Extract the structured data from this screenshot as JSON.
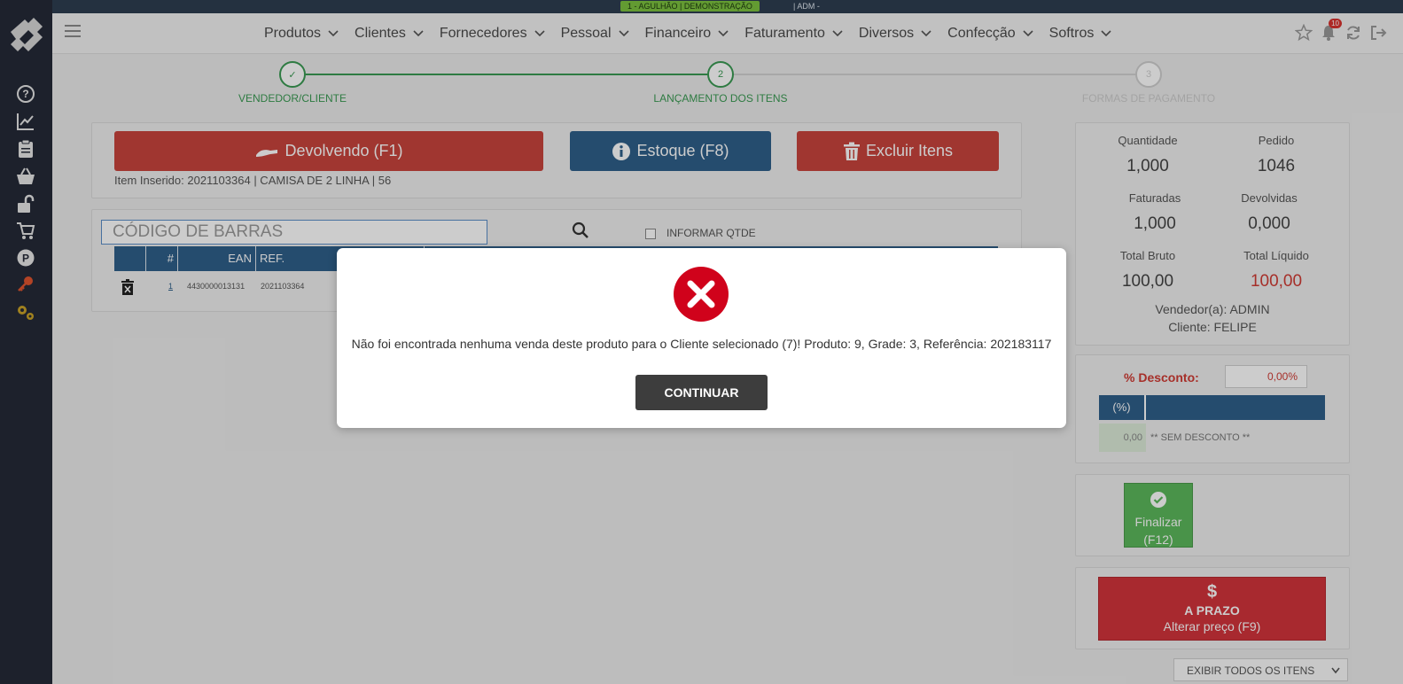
{
  "topbar": {
    "company": "1 - AGULHÃO | DEMONSTRAÇÃO",
    "user": "| ADM -"
  },
  "sidebar": {
    "icons": [
      "help-icon",
      "chart-icon",
      "clipboard-icon",
      "basket-icon",
      "unlock-icon",
      "cart-icon",
      "parking-icon",
      "key-icon",
      "gears-icon"
    ]
  },
  "header": {
    "nav": [
      "Produtos",
      "Clientes",
      "Fornecedores",
      "Pessoal",
      "Financeiro",
      "Faturamento",
      "Diversos",
      "Confecção",
      "Softros"
    ],
    "notifications": "10"
  },
  "stepper": {
    "steps": [
      {
        "num": "✓",
        "label": "VENDEDOR/CLIENTE"
      },
      {
        "num": "2",
        "label": "LANÇAMENTO DOS ITENS"
      },
      {
        "num": "3",
        "label": "FORMAS DE PAGAMENTO"
      }
    ]
  },
  "actions": {
    "devolvendo": "Devolvendo (F1)",
    "estoque": "Estoque (F8)",
    "excluir": "Excluir Itens",
    "item_inserido": "Item Inserido: 2021103364 | CAMISA DE 2 LINHA | 56"
  },
  "search": {
    "placeholder": "CÓDIGO DE BARRAS",
    "informar_qtde": "INFORMAR QTDE"
  },
  "table": {
    "headers": [
      "#",
      "EAN",
      "REF."
    ],
    "row": {
      "num": "1",
      "ean": "4430000013131",
      "ref": "2021103364"
    }
  },
  "summary": {
    "quantidade_label": "Quantidade",
    "quantidade": "1,000",
    "pedido_label": "Pedido",
    "pedido": "1046",
    "faturadas_label": "Faturadas",
    "faturadas": "1,000",
    "devolvidas_label": "Devolvidas",
    "devolvidas": "0,000",
    "total_bruto_label": "Total Bruto",
    "total_bruto": "100,00",
    "total_liquido_label": "Total Líquido",
    "total_liquido": "100,00",
    "vendedor": "Vendedor(a): ADMIN",
    "cliente": "Cliente: FELIPE"
  },
  "desconto": {
    "label": "% Desconto:",
    "value": "0,00%",
    "pct_header": "(%)",
    "zero": "0,00",
    "none": "** SEM DESCONTO **"
  },
  "finalizar": {
    "line1": "Finalizar",
    "line2": "(F12)"
  },
  "prazo": {
    "symbol": "$",
    "line1": "A PRAZO",
    "line2": "Alterar preço (F9)"
  },
  "filter": {
    "selected": "EXIBIR TODOS OS ITENS"
  },
  "modal": {
    "message": "Não foi encontrada nenhuma venda deste produto para o Cliente selecionado (7)! Produto: 9, Grade: 3, Referência: 202183117",
    "button": "CONTINUAR"
  },
  "colors": {
    "primary_blue": "#2f5f8a",
    "danger_red": "#c9443c",
    "success_green": "#5cb85c",
    "sidebar": "#252a38"
  }
}
